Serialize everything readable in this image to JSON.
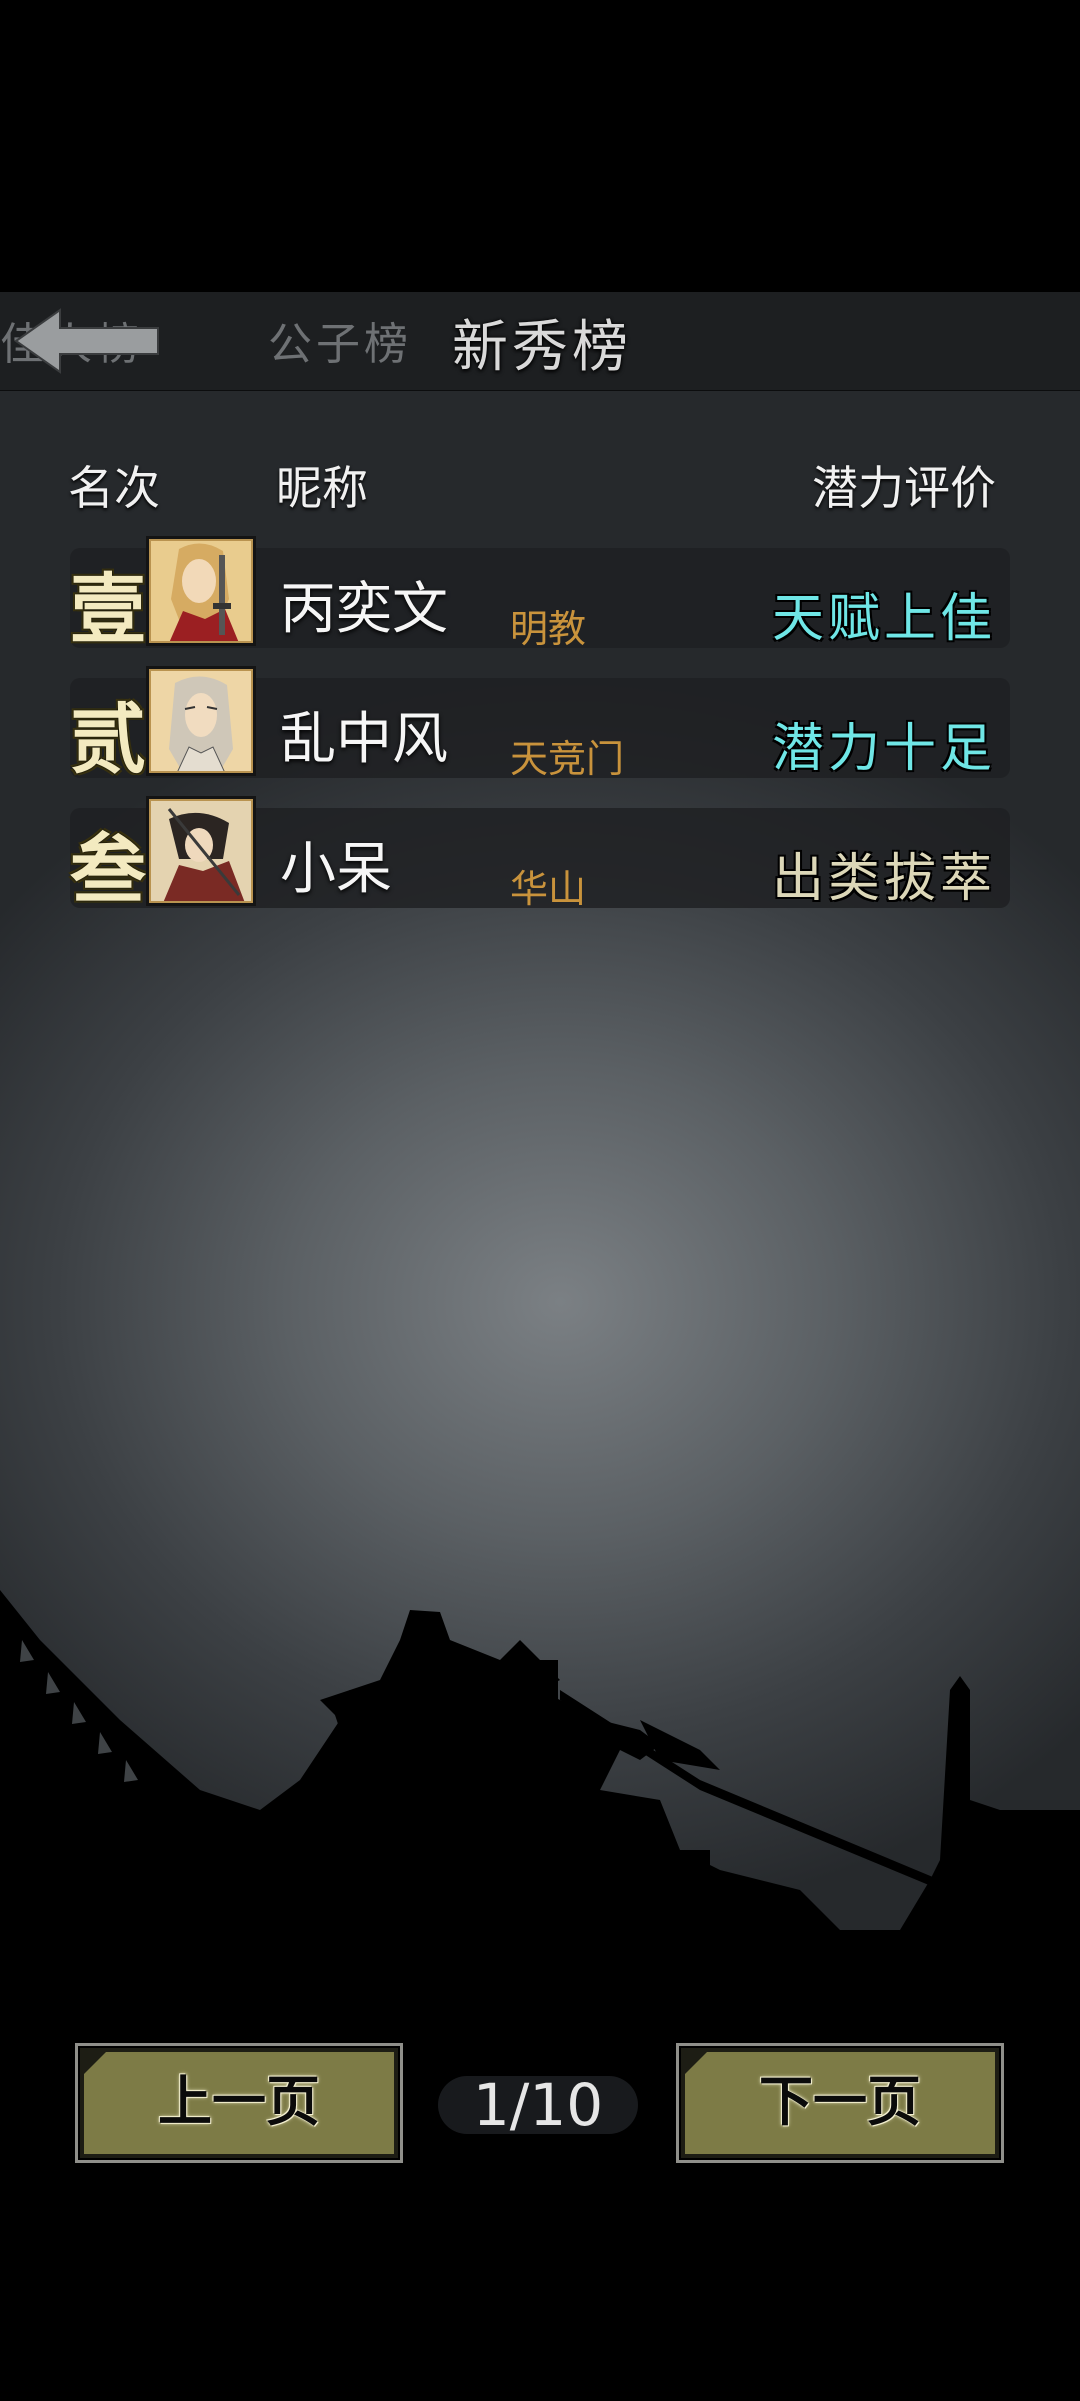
{
  "tabs": [
    {
      "label": "佳人榜",
      "active": false
    },
    {
      "label": "公子榜",
      "active": false
    },
    {
      "label": "新秀榜",
      "active": true
    }
  ],
  "columns": {
    "rank": "名次",
    "nickname": "昵称",
    "potential": "潜力评价"
  },
  "entries": [
    {
      "rank": "壹",
      "nickname": "丙奕文",
      "sect": "明教",
      "rating": "天赋上佳",
      "rating_color": "#6fe6e6",
      "avatar_icon": "female-swordswoman-portrait"
    },
    {
      "rank": "贰",
      "nickname": "乱中风",
      "sect": "天竞门",
      "rating": "潜力十足",
      "rating_color": "#6fe6e6",
      "avatar_icon": "long-haired-man-portrait"
    },
    {
      "rank": "叁",
      "nickname": "小呆",
      "sect": "华山",
      "rating": "出类拔萃",
      "rating_color": "#dcd7b8",
      "avatar_icon": "dark-robed-swordsman-portrait"
    }
  ],
  "pagination": {
    "prev_label": "上一页",
    "next_label": "下一页",
    "page": "1/10"
  },
  "colors": {
    "accent_button": "#7d7b46",
    "sect_text": "#c9933c",
    "rank_text": "#f3eac0"
  }
}
